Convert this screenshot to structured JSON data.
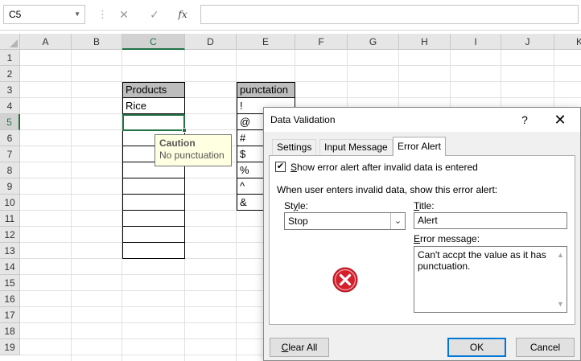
{
  "formula_bar": {
    "name_box": "C5",
    "separator": "⋮",
    "cancel_symbol": "✕",
    "enter_symbol": "✓",
    "fx_label": "fx",
    "formula": ""
  },
  "sheet": {
    "columns": [
      "A",
      "B",
      "C",
      "D",
      "E",
      "F",
      "G",
      "H",
      "I",
      "J",
      "K"
    ],
    "rows": [
      "1",
      "2",
      "3",
      "4",
      "5",
      "6",
      "7",
      "8",
      "9",
      "10",
      "11",
      "12",
      "13",
      "14",
      "15",
      "16",
      "17",
      "18",
      "19"
    ],
    "selected_column": "C",
    "selected_row": "5",
    "products_header": "Products",
    "products": [
      "Rice"
    ],
    "punctuation_header": "punctation",
    "punctuation": [
      "!",
      "@",
      "#",
      "$",
      "%",
      "^",
      "&"
    ]
  },
  "input_tooltip": {
    "title": "Caution",
    "message": "No punctuation"
  },
  "dialog": {
    "title": "Data Validation",
    "help_symbol": "?",
    "close_symbol": "✕",
    "tabs": [
      {
        "label": "Settings",
        "active": false
      },
      {
        "label": "Input Message",
        "active": false
      },
      {
        "label": "Error Alert",
        "active": true
      }
    ],
    "show_alert_checked": true,
    "show_alert_pre": "",
    "show_alert_key": "S",
    "show_alert_post": "how error alert after invalid data is entered",
    "when_invalid_text": "When user enters invalid data, show this error alert:",
    "style_pre": "St",
    "style_key": "y",
    "style_post": "le:",
    "style_value": "Stop",
    "title_pre": "",
    "title_key": "T",
    "title_post": "itle:",
    "title_value": "Alert",
    "message_pre": "",
    "message_key": "E",
    "message_post": "rror message:",
    "message_value": "Can't accpt the value as it has punctuation.",
    "icon": "stop-error-icon",
    "clear_key": "C",
    "clear_post": "lear All",
    "ok_label": "OK",
    "cancel_label": "Cancel"
  },
  "colors": {
    "excel_green": "#217346",
    "header_fill": "#bdbdbd",
    "tooltip_bg": "#ffffe1",
    "stop_red": "#d4202c",
    "ok_border": "#0078d7"
  }
}
